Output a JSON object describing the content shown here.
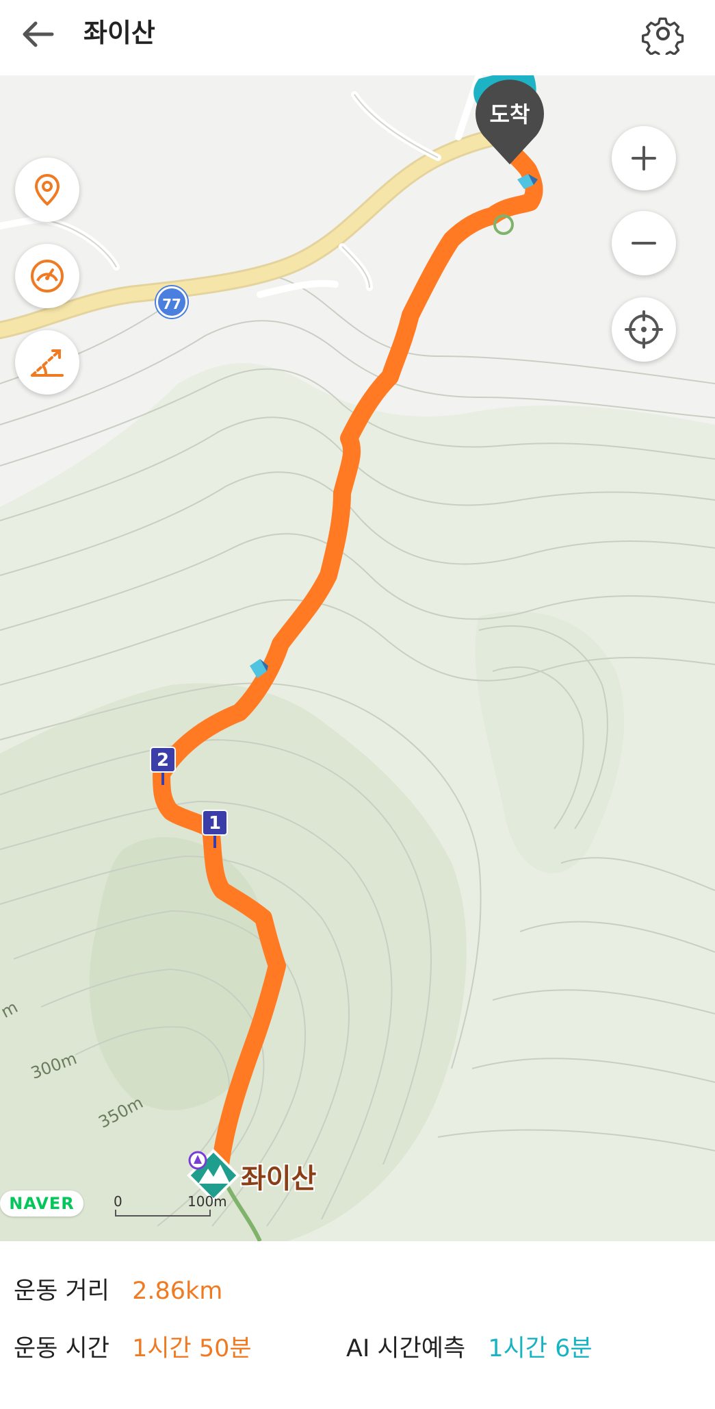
{
  "header": {
    "title": "좌이산"
  },
  "map": {
    "arrival_label": "도착",
    "road_number": "77",
    "peak_name": "좌이산",
    "contour_labels": [
      "300m",
      "350m",
      "m"
    ],
    "waypoints": [
      "1",
      "2"
    ],
    "brand": "NAVER",
    "scale": {
      "zero": "0",
      "max": "100m"
    },
    "route_color": "#ff7a22"
  },
  "stats": {
    "distance_label": "운동 거리",
    "distance_value": "2.86km",
    "time_label": "운동 시간",
    "time_value": "1시간 50분",
    "ai_label": "AI 시간예측",
    "ai_value": "1시간 6분"
  }
}
